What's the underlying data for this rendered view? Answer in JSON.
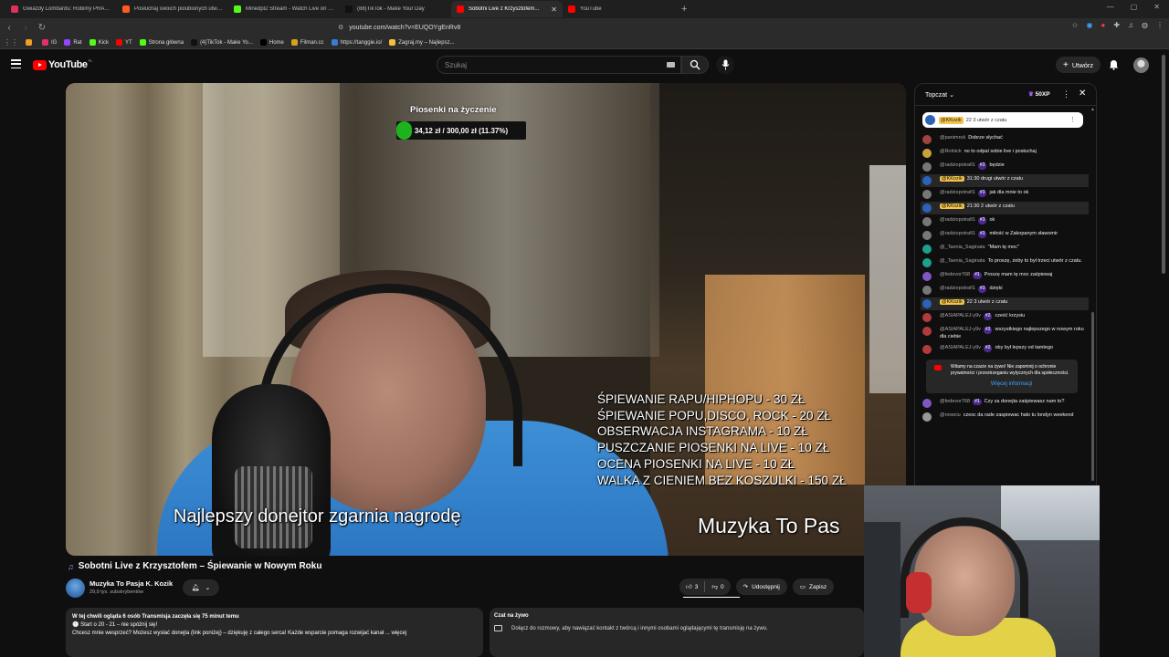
{
  "browser": {
    "tabs": [
      {
        "title": "Gwiazdy Lombardu: Robimy PRAWDZ...",
        "color": "#e0315b",
        "active": false
      },
      {
        "title": "Posłuchaj swoich polubionych utwor...",
        "color": "#ff5a1f",
        "active": false
      },
      {
        "title": "Minedpl2 Stream - Watch Live on Ki...",
        "color": "#53fc18",
        "active": false
      },
      {
        "title": "(88)TikTok - Make Your Day",
        "color": "#111111",
        "active": false
      },
      {
        "title": "Sobotni Live z Krzysztofem...",
        "color": "#ff0000",
        "active": true
      },
      {
        "title": "YouTube",
        "color": "#ff0000",
        "active": false
      }
    ],
    "new_tab": "+",
    "url": "youtube.com/watch?v=EUQOYgEnRv8",
    "bookmarks": [
      {
        "label": "",
        "color": "#f0a020"
      },
      {
        "label": "IG",
        "color": "#e1306c"
      },
      {
        "label": "Rat",
        "color": "#9146ff"
      },
      {
        "label": "Kick",
        "color": "#53fc18"
      },
      {
        "label": "YT",
        "color": "#ff0000"
      },
      {
        "label": "Strona główna",
        "color": "#53fc18"
      },
      {
        "label": "(4)TikTok - Make Yo...",
        "color": "#111111"
      },
      {
        "label": "Home",
        "color": "#000000"
      },
      {
        "label": "Filman.cc",
        "color": "#d4a21f"
      },
      {
        "label": "https://tanggie.io/",
        "color": "#3a7bd5"
      },
      {
        "label": "Zagraj.my – Najlepsz...",
        "color": "#f0c040"
      }
    ]
  },
  "masthead": {
    "logo_text": "YouTube",
    "country_code": "PL",
    "search_placeholder": "Szukaj",
    "create_label": "Utwórz"
  },
  "player": {
    "goal_title": "Piosenki na życzenie",
    "goal_text": "34,12 zł / 300,00 zł (11.37%)",
    "goal_progress": 0.1137,
    "price_list": [
      "ŚPIEWANIE RAPU/HIPHOPU - 30 ZŁ",
      "ŚPIEWANIE POPU,DISCO, ROCK - 20 ZŁ",
      "OBSERWACJA INSTAGRAMA - 10 ZŁ",
      "PUSZCZANIE PIOSENKI NA LIVE - 10 ZŁ",
      "OCENA PIOSENKI NA LIVE - 10 ZŁ",
      "WALKA Z CIENIEM BEZ KOSZULKI - 150 ZŁ"
    ],
    "overlay_left": "Najlepszy donejtor zgarnia nagrodę",
    "overlay_right": "Muzyka To Pas"
  },
  "chat": {
    "mode": "Topczat",
    "points": "50XP",
    "pinned": {
      "author": "@KKozik",
      "text": "22 3 utwór z czatu"
    },
    "messages": [
      {
        "author": "@panimruk",
        "badge": "",
        "text": "Dobrze słychać",
        "owner": false,
        "hl": false,
        "color": "#a0453d"
      },
      {
        "author": "@Rolnick",
        "badge": "",
        "text": "no to odpal sobie live i posłuchaj",
        "owner": false,
        "hl": false,
        "color": "#c9a23a"
      },
      {
        "author": "@radziopotrafi1",
        "badge": "#3",
        "text": "będzie",
        "owner": false,
        "hl": false,
        "color": "#777777"
      },
      {
        "author": "@KKozik",
        "badge": "",
        "text": "31:30 drugi utwór z czatu",
        "owner": true,
        "hl": true,
        "color": "#2c62b8"
      },
      {
        "author": "@radziopotrafi1",
        "badge": "#3",
        "text": "jak dla mnie to ok",
        "owner": false,
        "hl": false,
        "color": "#777777"
      },
      {
        "author": "@KKozik",
        "badge": "",
        "text": "21:30 2 utwór z czatu",
        "owner": true,
        "hl": true,
        "color": "#2c62b8"
      },
      {
        "author": "@radziopotrafi1",
        "badge": "#3",
        "text": "ok",
        "owner": false,
        "hl": false,
        "color": "#777777"
      },
      {
        "author": "@radziopotrafi1",
        "badge": "#3",
        "text": "miłość w Zakopanym sławomir",
        "owner": false,
        "hl": false,
        "color": "#777777"
      },
      {
        "author": "@_Taenia_Saginata",
        "badge": "",
        "text": "\"Mam tę moc\"",
        "owner": false,
        "hl": false,
        "color": "#1f9e8a"
      },
      {
        "author": "@_Taenia_Saginata",
        "badge": "",
        "text": "To proszę, żeby to był trzeci utwór z czatu.",
        "owner": false,
        "hl": false,
        "color": "#1f9e8a"
      },
      {
        "author": "@fedevor768",
        "badge": "#1",
        "text": "Proszę mam tę moc zaśpiewaj",
        "owner": false,
        "hl": false,
        "color": "#7e57c2"
      },
      {
        "author": "@radziopotrafi1",
        "badge": "#3",
        "text": "dzięki",
        "owner": false,
        "hl": false,
        "color": "#777777"
      },
      {
        "author": "@KKozik",
        "badge": "",
        "text": "22 3 utwór z czatu",
        "owner": true,
        "hl": true,
        "color": "#2c62b8"
      },
      {
        "author": "@ASIAPALEJ-y9v",
        "badge": "#2",
        "text": "cześć krzysiu",
        "owner": false,
        "hl": false,
        "color": "#b33a3a"
      },
      {
        "author": "@ASIAPALEJ-y9v",
        "badge": "#2",
        "text": "wszystkiego najlepszego w nowym roku dla ciebie",
        "owner": false,
        "hl": false,
        "color": "#b33a3a"
      },
      {
        "author": "@ASIAPALEJ-y9v",
        "badge": "#2",
        "text": "oby był lepszy od tamtego",
        "owner": false,
        "hl": false,
        "color": "#b33a3a"
      }
    ],
    "notice_text": "Witamy na czacie na żywo! Nie zapomnij o ochronie prywatności i przestrzeganiu wytycznych dla społeczności.",
    "notice_link": "Więcej informacji",
    "messages_after": [
      {
        "author": "@fedevor768",
        "badge": "#1",
        "text": "Czy za donejta zaśpiewasz nam to?",
        "owner": false,
        "hl": false,
        "color": "#7e57c2"
      },
      {
        "author": "@nowciu",
        "badge": "",
        "text": "czesc da rade zaspiewac halo tu londyn weekend",
        "owner": false,
        "hl": false,
        "color": "#999999"
      }
    ]
  },
  "video": {
    "title": "Sobotni Live z Krzysztofem – Śpiewanie w Nowym Roku",
    "channel": "Muzyka To Pasja K. Kozik",
    "subscribers": "29,9 tys. subskrybentów",
    "likes": "3",
    "dislikes": "0",
    "share_label": "Udostępnij",
    "save_label": "Zapisz",
    "desc_meta": "W tej chwili ogląda 6 osób  Transmisja zaczęła się 75 minut temu",
    "desc_line1": "🕘 Start o 20 - 21 – nie spóźnij się!",
    "desc_line2": "Chcesz mnie wesprzeć? Możesz wysłać donejta (link poniżej) – dziękuję z całego serca! Każde wsparcie pomaga rozwijać kanał ... więcej",
    "livechat_title": "Czat na żywo",
    "livechat_text": "Dołącz do rozmowy, aby nawiązać kontakt z twórcą i innymi osobami oglądającymi tę transmisję na żywo."
  }
}
